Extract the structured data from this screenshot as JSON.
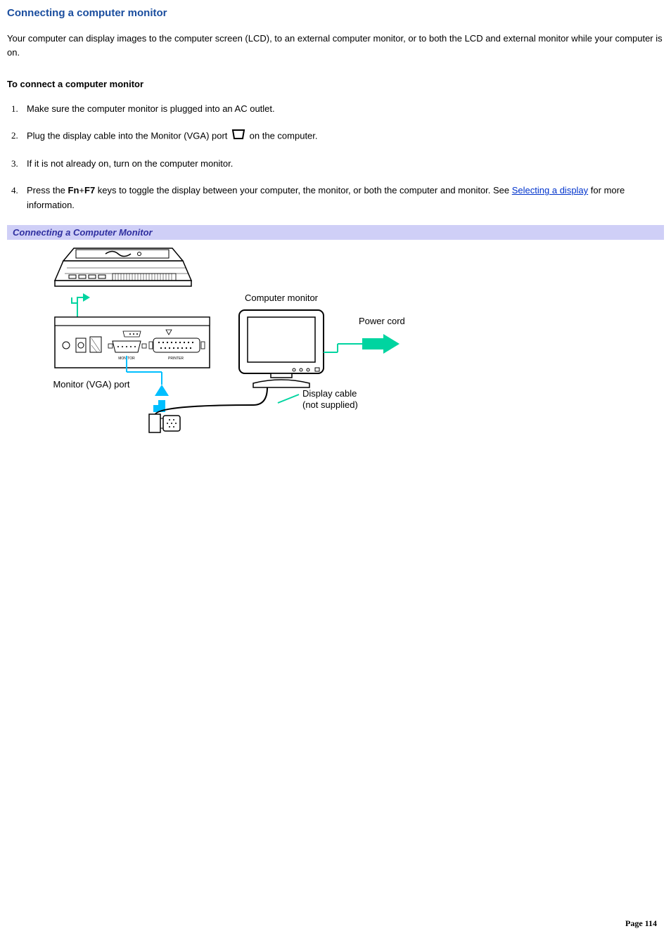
{
  "heading": "Connecting a computer monitor",
  "intro": "Your computer can display images to the computer screen (LCD), to an external computer monitor, or to both the LCD and external monitor while your computer is on.",
  "sub_heading": "To connect a computer monitor",
  "steps": {
    "s1": "Make sure the computer monitor is plugged into an AC outlet.",
    "s2a": "Plug the display cable into the Monitor (VGA) port ",
    "s2b": " on the computer.",
    "s3": "If it is not already on, turn on the computer monitor.",
    "s4a": "Press the ",
    "s4_key1": "Fn",
    "s4_plus": "+",
    "s4_key2": "F7",
    "s4b": " keys to toggle the display between your computer, the monitor, or both the computer and monitor. See ",
    "s4_link": "Selecting a display",
    "s4c": " for more information."
  },
  "figure_caption": "Connecting a Computer Monitor",
  "labels": {
    "computer_monitor": "Computer monitor",
    "power_cord": "Power cord",
    "vga_port": "Monitor (VGA) port",
    "display_cable_1": "Display cable",
    "display_cable_2": "(not supplied)"
  },
  "footer": {
    "page_label": "Page 114"
  }
}
